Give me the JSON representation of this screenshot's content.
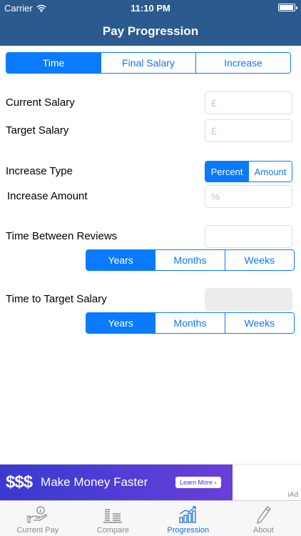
{
  "status_bar": {
    "carrier": "Carrier",
    "time": "11:10 PM"
  },
  "nav": {
    "title": "Pay Progression"
  },
  "mode_segment": {
    "options": [
      "Time",
      "Final Salary",
      "Increase"
    ],
    "selected": "Time"
  },
  "form": {
    "current_salary_label": "Current Salary",
    "current_salary_placeholder": "£",
    "target_salary_label": "Target Salary",
    "target_salary_placeholder": "£",
    "increase_type_label": "Increase Type",
    "increase_type_options": [
      "Percent",
      "Amount"
    ],
    "increase_type_selected": "Percent",
    "increase_amount_label": "Increase Amount",
    "increase_amount_placeholder": "%",
    "time_between_reviews_label": "Time Between Reviews",
    "time_between_reviews_value": "",
    "review_units": [
      "Years",
      "Months",
      "Weeks"
    ],
    "review_units_selected": "Years",
    "time_to_target_label": "Time to Target Salary",
    "time_to_target_value": "",
    "target_units": [
      "Years",
      "Months",
      "Weeks"
    ],
    "target_units_selected": "Years"
  },
  "ad": {
    "dollars": "$$$",
    "text": "Make Money Faster",
    "button": "Learn More ›",
    "badge": "iAd"
  },
  "tabs": [
    {
      "label": "Current Pay",
      "icon": "hand-money-icon",
      "active": false
    },
    {
      "label": "Compare",
      "icon": "compare-bars-icon",
      "active": false
    },
    {
      "label": "Progression",
      "icon": "growth-chart-icon",
      "active": true
    },
    {
      "label": "About",
      "icon": "pen-icon",
      "active": false
    }
  ],
  "colors": {
    "nav_bg": "#2b5a8f",
    "accent": "#0a7aff",
    "tab_active": "#1b6fe0"
  }
}
